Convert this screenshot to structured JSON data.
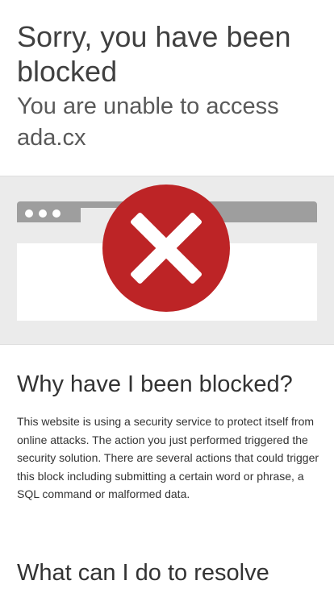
{
  "header": {
    "title": "Sorry, you have been blocked",
    "subtitle": "You are unable to access ada.cx"
  },
  "illustration": {
    "icon": "blocked-x-icon",
    "colors": {
      "icon_circle": "#bd2426",
      "browser_bar": "#9e9e9e",
      "band_background": "#ebebeb"
    }
  },
  "why_blocked": {
    "heading": "Why have I been blocked?",
    "body": "This website is using a security service to protect itself from online attacks. The action you just performed triggered the security solution. There are several actions that could trigger this block including submitting a certain word or phrase, a SQL command or malformed data."
  },
  "resolve": {
    "heading": "What can I do to resolve"
  }
}
